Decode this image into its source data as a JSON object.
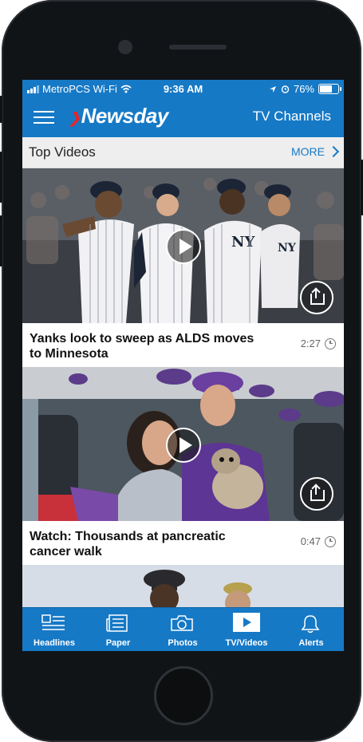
{
  "status": {
    "carrier": "MetroPCS Wi-Fi",
    "time": "9:36 AM",
    "battery": "76%",
    "battery_level": 0.76
  },
  "header": {
    "logo": "Newsday",
    "right_link": "TV Channels"
  },
  "section": {
    "title": "Top Videos",
    "more": "MORE"
  },
  "videos": [
    {
      "title": "Yanks look to sweep as ALDS moves to Minnesota",
      "duration": "2:27"
    },
    {
      "title": "Watch: Thousands at pancreatic cancer walk",
      "duration": "0:47"
    }
  ],
  "tabs": [
    {
      "label": "Headlines",
      "icon": "headlines-icon"
    },
    {
      "label": "Paper",
      "icon": "paper-icon"
    },
    {
      "label": "Photos",
      "icon": "camera-icon"
    },
    {
      "label": "TV/Videos",
      "icon": "play-icon"
    },
    {
      "label": "Alerts",
      "icon": "bell-icon"
    }
  ],
  "colors": {
    "brand": "#1679c6",
    "logo_accent": "#e3262b"
  }
}
